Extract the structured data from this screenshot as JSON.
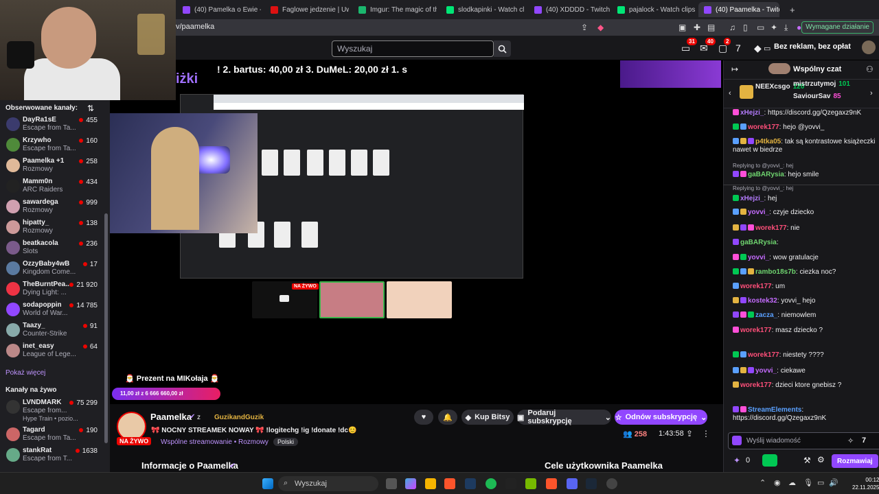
{
  "browser": {
    "tabs": [
      {
        "label": "(40) Pamelka o Ewie - Twit",
        "fav": "#9147ff"
      },
      {
        "label": "Faglowe jedzenie | UwUFU",
        "fav": "#d11"
      },
      {
        "label": "Imgur: The magic of the In",
        "fav": "#1bb76e"
      },
      {
        "label": "slodkapinki - Watch clips o",
        "fav": "#00e676"
      },
      {
        "label": "(40) XDDDD - Twitch",
        "fav": "#9147ff"
      },
      {
        "label": "pajalock - Watch clips on",
        "fav": "#00e676"
      },
      {
        "label": "(40) Paamelka - Twitch",
        "fav": "#9147ff"
      }
    ],
    "url": "v/paamelka",
    "required_action": "Wymagane działanie"
  },
  "nav": {
    "search_placeholder": "Wyszukaj",
    "badge_a": "31",
    "badge_b": "40",
    "badge_c": "2",
    "no_ads": "Bez reklam, bez opłat"
  },
  "sidebar": {
    "followed_title": "Obserwowane kanały:",
    "followed": [
      {
        "name": "DayRa1sE",
        "cat": "Escape from Ta...",
        "viewers": "455",
        "color": "#3b3b6d"
      },
      {
        "name": "Krzywho",
        "cat": "Escape from Ta...",
        "viewers": "160",
        "color": "#4f8a3a"
      },
      {
        "name": "Paamelka +1",
        "cat": "Rozmowy",
        "viewers": "258",
        "color": "#e0b999"
      },
      {
        "name": "Mamm0n",
        "cat": "ARC Raiders",
        "viewers": "434",
        "color": "#222"
      },
      {
        "name": "sawardega",
        "cat": "Rozmowy",
        "viewers": "999",
        "color": "#d0a0b0"
      },
      {
        "name": "hipatty_",
        "cat": "Rozmowy",
        "viewers": "138",
        "color": "#c99"
      },
      {
        "name": "beatkacola",
        "cat": "Slots",
        "viewers": "236",
        "color": "#7a5a8a"
      },
      {
        "name": "OzzyBaby4wB",
        "cat": "Kingdom Come...",
        "viewers": "17",
        "color": "#5a7aa0"
      },
      {
        "name": "TheBurntPea...",
        "cat": "Dying Light: ...",
        "viewers": "21 920",
        "color": "#e34"
      },
      {
        "name": "sodapoppin",
        "cat": "World of War...",
        "viewers": "14 785",
        "color": "#9147ff"
      },
      {
        "name": "Taazy_",
        "cat": "Counter-Strike",
        "viewers": "91",
        "color": "#8aa"
      },
      {
        "name": "inet_easy",
        "cat": "League of Lege...",
        "viewers": "64",
        "color": "#b88"
      }
    ],
    "show_more": "Pokaż więcej",
    "live_title": "Kanały na żywo",
    "live": [
      {
        "name": "LVNDMARK",
        "cat": "Escape from...",
        "viewers": "75 299",
        "extra": "Hype Train • pozio...",
        "color": "#333"
      },
      {
        "name": "Tagard",
        "cat": "Escape from Ta...",
        "viewers": "190",
        "color": "#c66"
      },
      {
        "name": "stankRat",
        "cat": "Escape from T...",
        "viewers": "1638",
        "color": "#6a8"
      }
    ]
  },
  "player": {
    "donations": "! 2. bartus: 40,00 zł 3. DuMeL: 20,00 zł 1. s",
    "overlay_text": "iżki",
    "live_small": "NA ŻYWO",
    "gift_title": "🎅 Prezent na MIKołaja 🎅",
    "gift_progress": "11,00 zł z 6 666 660,00 zł"
  },
  "info": {
    "channel": "Paamelka",
    "with": "z",
    "collab": "GuzikandGuzik",
    "live_badge": "NA ŻYWO",
    "title": "🎀 NOCNY STREAMEK NOWAY 🎀 !logitechg !ig !donate !dc😊",
    "shared": "Wspólne streamowanie",
    "category": "Rozmowy",
    "sep": "•",
    "language": "Polski",
    "bits": "Kup Bitsy",
    "gift_sub": "Podaruj subskrypcję",
    "renew": "Odnów subskrypcję",
    "viewers": "258",
    "uptime": "1:43:58",
    "about": "Informacje o Paamelka",
    "goals": "Cele użytkownika Paamelka"
  },
  "chat": {
    "title": "Wspólny czat",
    "gifters": [
      {
        "name": "NEEXcsgo",
        "count": "120"
      },
      {
        "name": "mistrzutymoj",
        "count": "101"
      },
      {
        "name": "SaviourSav",
        "count": "85"
      }
    ],
    "messages": [
      {
        "user": "xHejzi_",
        "text": ": https://discord.gg/Qzegaxz9nK",
        "color": "#b57cff"
      },
      {
        "user": "worek177",
        "text": ": hejo @yovvi_",
        "color": "#ff4f7a"
      },
      {
        "user": "p4tka05",
        "text": ": tak są kontrastowe książeczki nawet w biedrze",
        "color": "#e3b341"
      },
      {
        "reply": "Replying to @yovvi_: hej"
      },
      {
        "user": "gaBARysia",
        "text": ": hejo smile",
        "color": "#6fd46f"
      },
      {
        "reply": "Replying to @yovvi_: hej"
      },
      {
        "user": "xHejzi_",
        "text": ": hej",
        "color": "#b57cff"
      },
      {
        "user": "yovvi_",
        "text": ": czyje dziecko",
        "color": "#c56cff"
      },
      {
        "user": "worek177",
        "text": ": nie",
        "color": "#ff4f7a"
      },
      {
        "user": "gaBARysia",
        "text": ":",
        "color": "#6fd46f"
      },
      {
        "user": "yovvi_",
        "text": ": wow gratulacje",
        "color": "#c56cff"
      },
      {
        "user": "rambo18s7b",
        "text": ": ciezka noc?",
        "color": "#6fd46f"
      },
      {
        "user": "worek177",
        "text": ": um",
        "color": "#ff4f7a"
      },
      {
        "user": "kostek32",
        "text": ": yovvi_ hejo",
        "color": "#c56cff"
      },
      {
        "user": "zacza_",
        "text": ": niemowlem",
        "color": "#5aa0ff"
      },
      {
        "user": "worek177",
        "text": ": masz dziecko ?",
        "color": "#ff4f7a"
      },
      {
        "user": "worek177",
        "text": ": niestety ????",
        "color": "#ff4f7a"
      },
      {
        "user": "yovvi_",
        "text": ": ciekawe",
        "color": "#c56cff"
      },
      {
        "user": "worek177",
        "text": ": dzieci ktore gnebisz ?",
        "color": "#ff4f7a"
      },
      {
        "user": "StreamElements",
        "text": ": https://discord.gg/Qzegaxz9nK",
        "color": "#5aa0ff"
      }
    ],
    "input_placeholder": "Wyślij wiadomość",
    "points": "0",
    "send": "Rozmawiaj"
  },
  "taskbar": {
    "search": "Wyszukaj",
    "time": "00:12",
    "date": "22.11.2025"
  }
}
